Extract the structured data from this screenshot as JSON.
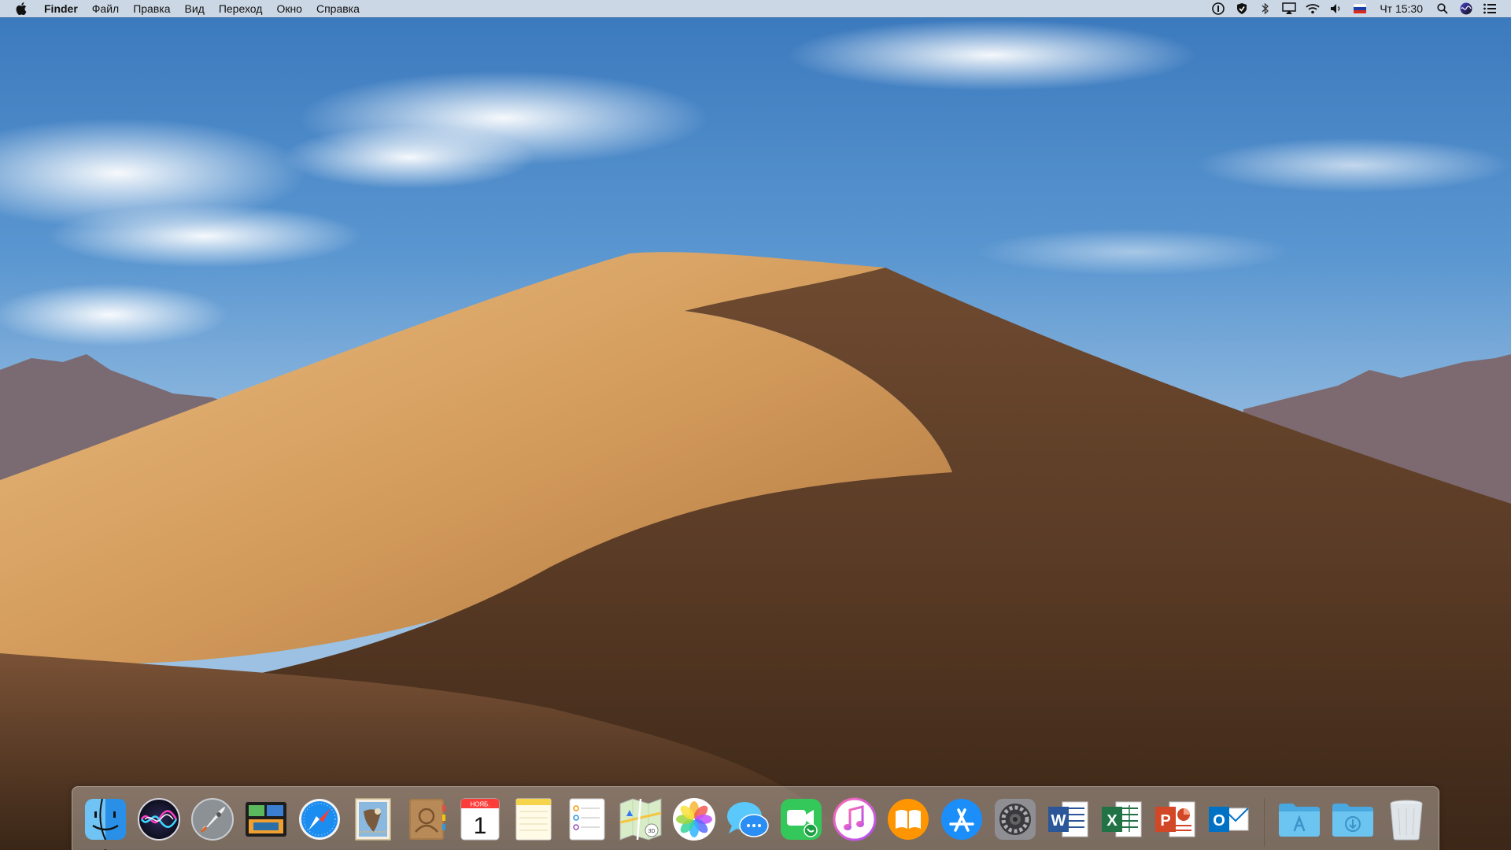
{
  "menubar": {
    "app_name": "Finder",
    "items": [
      "Файл",
      "Правка",
      "Вид",
      "Переход",
      "Окно",
      "Справка"
    ],
    "clock": "Чт 15:30",
    "status_icons": [
      "onepassword-icon",
      "shield-icon",
      "bluetooth-icon",
      "airplay-icon",
      "wifi-icon",
      "volume-icon",
      "language-flag-icon",
      "spotlight-icon",
      "siri-icon",
      "notification-center-icon"
    ]
  },
  "calendar": {
    "month": "НОЯБ.",
    "day": "1"
  },
  "dock": {
    "apps": [
      {
        "name": "Finder",
        "icon": "finder-icon",
        "running": true
      },
      {
        "name": "Siri",
        "icon": "siri-icon",
        "running": false
      },
      {
        "name": "Launchpad",
        "icon": "launchpad-icon",
        "running": false
      },
      {
        "name": "Mission Control",
        "icon": "mission-control-icon",
        "running": false
      },
      {
        "name": "Safari",
        "icon": "safari-icon",
        "running": false
      },
      {
        "name": "Mail",
        "icon": "mail-icon",
        "running": false
      },
      {
        "name": "Contacts",
        "icon": "contacts-icon",
        "running": false
      },
      {
        "name": "Calendar",
        "icon": "calendar-icon",
        "running": false
      },
      {
        "name": "Notes",
        "icon": "notes-icon",
        "running": false
      },
      {
        "name": "Reminders",
        "icon": "reminders-icon",
        "running": false
      },
      {
        "name": "Maps",
        "icon": "maps-icon",
        "running": false
      },
      {
        "name": "Photos",
        "icon": "photos-icon",
        "running": false
      },
      {
        "name": "Messages",
        "icon": "messages-icon",
        "running": false
      },
      {
        "name": "FaceTime",
        "icon": "facetime-icon",
        "running": false
      },
      {
        "name": "iTunes",
        "icon": "itunes-icon",
        "running": false
      },
      {
        "name": "Books",
        "icon": "books-icon",
        "running": false
      },
      {
        "name": "App Store",
        "icon": "app-store-icon",
        "running": false
      },
      {
        "name": "System Preferences",
        "icon": "system-preferences-icon",
        "running": false
      },
      {
        "name": "Microsoft Word",
        "icon": "word-icon",
        "running": false
      },
      {
        "name": "Microsoft Excel",
        "icon": "excel-icon",
        "running": false
      },
      {
        "name": "Microsoft PowerPoint",
        "icon": "powerpoint-icon",
        "running": false
      },
      {
        "name": "Microsoft Outlook",
        "icon": "outlook-icon",
        "running": false
      }
    ],
    "folders": [
      {
        "name": "Applications",
        "icon": "applications-folder-icon"
      },
      {
        "name": "Downloads",
        "icon": "downloads-folder-icon"
      },
      {
        "name": "Trash",
        "icon": "trash-icon"
      }
    ]
  },
  "colors": {
    "word": "#2b579a",
    "excel": "#217346",
    "powerpoint": "#d24726",
    "outlook": "#0072c6",
    "folder": "#6cc4f0"
  }
}
